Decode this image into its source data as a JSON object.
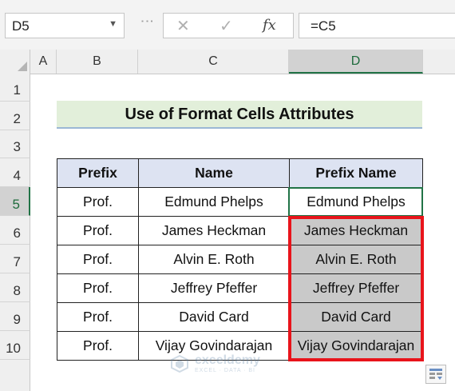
{
  "formula_bar": {
    "name_box": "D5",
    "formula": "=C5",
    "cancel_glyph": "✕",
    "enter_glyph": "✓",
    "fx_label": "fx"
  },
  "columns": [
    "A",
    "B",
    "C",
    "D"
  ],
  "active_column": "D",
  "rows": [
    "1",
    "2",
    "3",
    "4",
    "5",
    "6",
    "7",
    "8",
    "9",
    "10"
  ],
  "active_row": "5",
  "title": "Use of Format Cells Attributes",
  "table": {
    "headers": [
      "Prefix",
      "Name",
      "Prefix Name"
    ],
    "rows": [
      [
        "Prof.",
        "Edmund Phelps",
        "Edmund Phelps"
      ],
      [
        "Prof.",
        "James Heckman",
        "James Heckman"
      ],
      [
        "Prof.",
        "Alvin E. Roth",
        "Alvin E. Roth"
      ],
      [
        "Prof.",
        "Jeffrey Pfeffer",
        "Jeffrey Pfeffer"
      ],
      [
        "Prof.",
        "David Card",
        "David Card"
      ],
      [
        "Prof.",
        "Vijay Govindarajan",
        "Vijay Govindarajan"
      ]
    ]
  },
  "watermark": {
    "name": "exceldemy",
    "tagline": "EXCEL · DATA · BI"
  },
  "colors": {
    "excel_green": "#217346",
    "highlight_red": "#e8141b",
    "header_fill": "#dde3f2",
    "title_fill": "#e2efda",
    "grey_fill": "#c9c9c9"
  },
  "icons": [
    "chevron-down-icon",
    "cancel-icon",
    "enter-icon",
    "function-icon",
    "quick-analysis-icon",
    "exceldemy-logo-icon"
  ]
}
